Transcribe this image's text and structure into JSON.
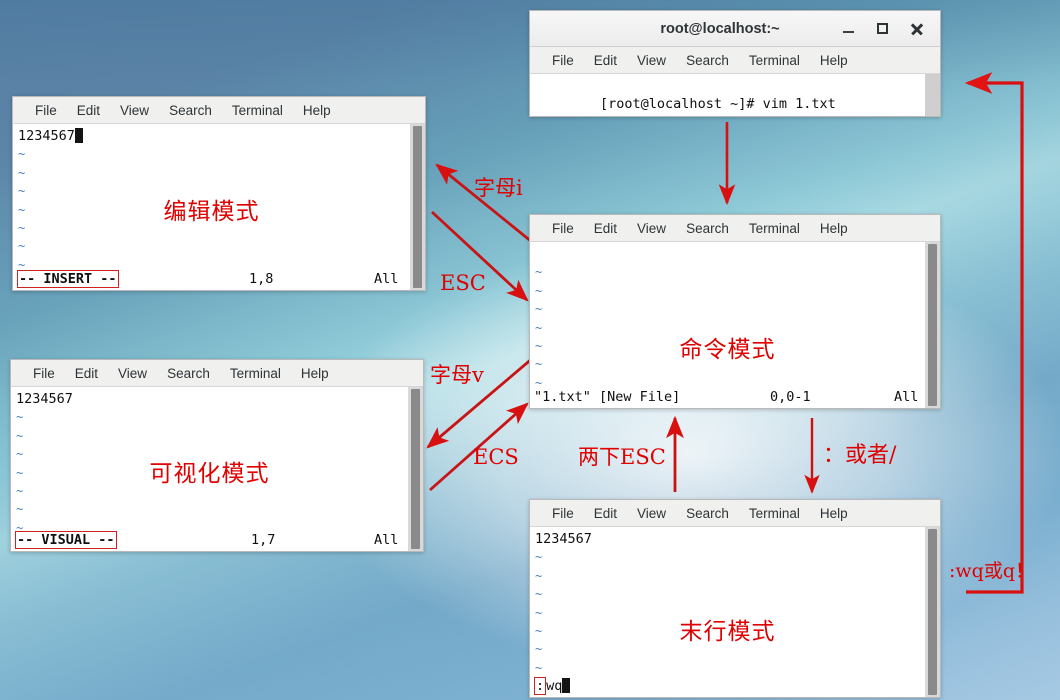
{
  "menu": {
    "items": [
      "File",
      "Edit",
      "View",
      "Search",
      "Terminal",
      "Help"
    ]
  },
  "windows": {
    "shell": {
      "title": "root@localhost:~",
      "minimize_icon": "minimize-icon",
      "maximize_icon": "maximize-icon",
      "close_icon": "close-icon",
      "prompt_line": "[root@localhost ~]# vim 1.txt"
    },
    "edit": {
      "mode_label": "编辑模式",
      "text_line": "1234567",
      "tildes": [
        "~",
        "~",
        "~",
        "~",
        "~",
        "~",
        "~"
      ],
      "status_mode": "-- INSERT --",
      "status_pos": "1,8",
      "status_pct": "All"
    },
    "visual": {
      "mode_label": "可视化模式",
      "text_line": "1234567",
      "tildes": [
        "~",
        "~",
        "~",
        "~",
        "~",
        "~",
        "~"
      ],
      "status_mode": "-- VISUAL --",
      "status_pos": "1,7",
      "status_pct": "All"
    },
    "command": {
      "mode_label": "命令模式",
      "text_line": "",
      "tildes": [
        "~",
        "~",
        "~",
        "~",
        "~",
        "~",
        "~"
      ],
      "status_file": "\"1.txt\" [New File]",
      "status_pos": "0,0-1",
      "status_pct": "All"
    },
    "lastline": {
      "mode_label": "末行模式",
      "text_line": "1234567",
      "tildes": [
        "~",
        "~",
        "~",
        "~",
        "~",
        "~",
        "~"
      ],
      "status_colon": ":",
      "status_cmd": "wq"
    }
  },
  "annotations": {
    "letter_i": "字母i",
    "esc": "ESC",
    "letter_v": "字母v",
    "ecs": "ECS",
    "two_esc": "两下ESC",
    "colon_or_slash": "：或者/",
    "wq_or_q": ":wq或q！"
  },
  "colors": {
    "accent_red": "#e00000",
    "arrow_red": "#d81010",
    "terminal_bg": "#ffffff",
    "titlebar_bg": "#f0f0ef",
    "tilde_blue": "#4a7fbf"
  }
}
